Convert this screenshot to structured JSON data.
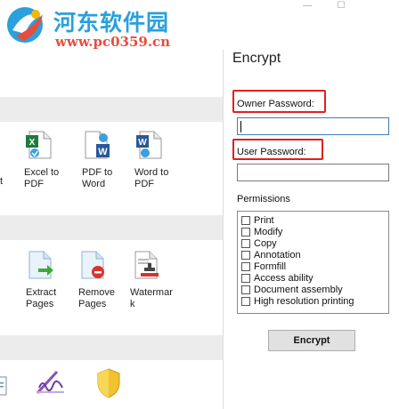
{
  "watermark": {
    "title": "河东软件园",
    "url": "www.pc0359.cn"
  },
  "tools_row1": [
    {
      "label": "Excel to\nPDF",
      "icon": "excel-to-pdf-icon"
    },
    {
      "label": "PDF to\nWord",
      "icon": "pdf-to-word-icon"
    },
    {
      "label": "Word to\nPDF",
      "icon": "word-to-pdf-icon"
    }
  ],
  "tools_row1_partial": "t",
  "tools_row2": [
    {
      "label": "Extract\nPages",
      "icon": "extract-pages-icon"
    },
    {
      "label": "Remove\nPages",
      "icon": "remove-pages-icon"
    },
    {
      "label": "Watermar\nk",
      "icon": "watermark-icon"
    }
  ],
  "encrypt": {
    "title": "Encrypt",
    "owner_password_label": "Owner Password:",
    "owner_password_value": "",
    "user_password_label": "User Password:",
    "user_password_value": "",
    "permissions_label": "Permissions",
    "permissions": [
      {
        "label": "Print",
        "checked": false
      },
      {
        "label": "Modify",
        "checked": false
      },
      {
        "label": "Copy",
        "checked": false
      },
      {
        "label": "Annotation",
        "checked": false
      },
      {
        "label": "Formfill",
        "checked": false
      },
      {
        "label": "Access ability",
        "checked": false
      },
      {
        "label": "Document assembly",
        "checked": false
      },
      {
        "label": "High resolution printing",
        "checked": false
      }
    ],
    "button_label": "Encrypt"
  },
  "colors": {
    "highlight": "#e0201e",
    "watermark_blue": "#2aa0dc",
    "watermark_red": "#e84c3d",
    "section_bar": "#ececec"
  }
}
